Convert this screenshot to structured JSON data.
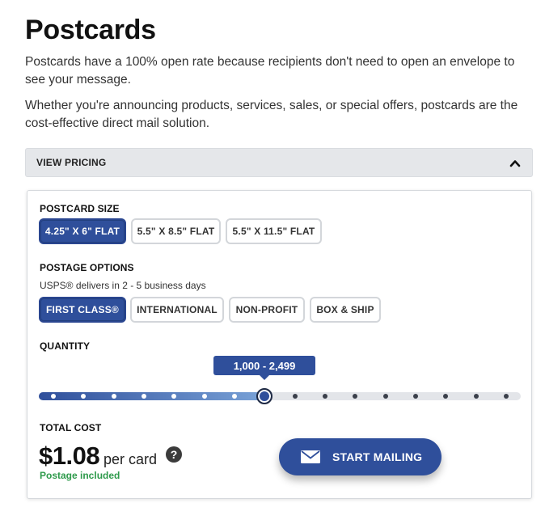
{
  "page": {
    "title": "Postcards",
    "paragraph1": "Postcards have a 100% open rate because recipients don't need to open an envelope to see your message.",
    "paragraph2": "Whether you're announcing products, services, sales, or special offers, postcards are the cost-effective direct mail solution."
  },
  "accordion": {
    "label": "VIEW PRICING",
    "icon": "chevron-up-icon",
    "expanded": true
  },
  "postcard_size": {
    "label": "POSTCARD SIZE",
    "options": [
      "4.25\" X 6\" FLAT",
      "5.5\" X 8.5\" FLAT",
      "5.5\" X 11.5\" FLAT"
    ],
    "selected_index": 0
  },
  "postage": {
    "label": "POSTAGE OPTIONS",
    "sublabel": "USPS® delivers in 2 - 5 business days",
    "options": [
      "FIRST CLASS®",
      "INTERNATIONAL",
      "NON-PROFIT",
      "BOX & SHIP"
    ],
    "selected_index": 0
  },
  "quantity": {
    "label": "QUANTITY",
    "selected_range": "1,000 - 2,499",
    "steps": 16,
    "selected_step": 7
  },
  "total": {
    "label": "TOTAL COST",
    "price": "$1.08",
    "unit": "per card",
    "help_glyph": "?",
    "note": "Postage included"
  },
  "cta": {
    "label": "START MAILING",
    "icon": "envelope-icon"
  },
  "colors": {
    "primary": "#2f4f9b",
    "success": "#2e9a4b"
  }
}
